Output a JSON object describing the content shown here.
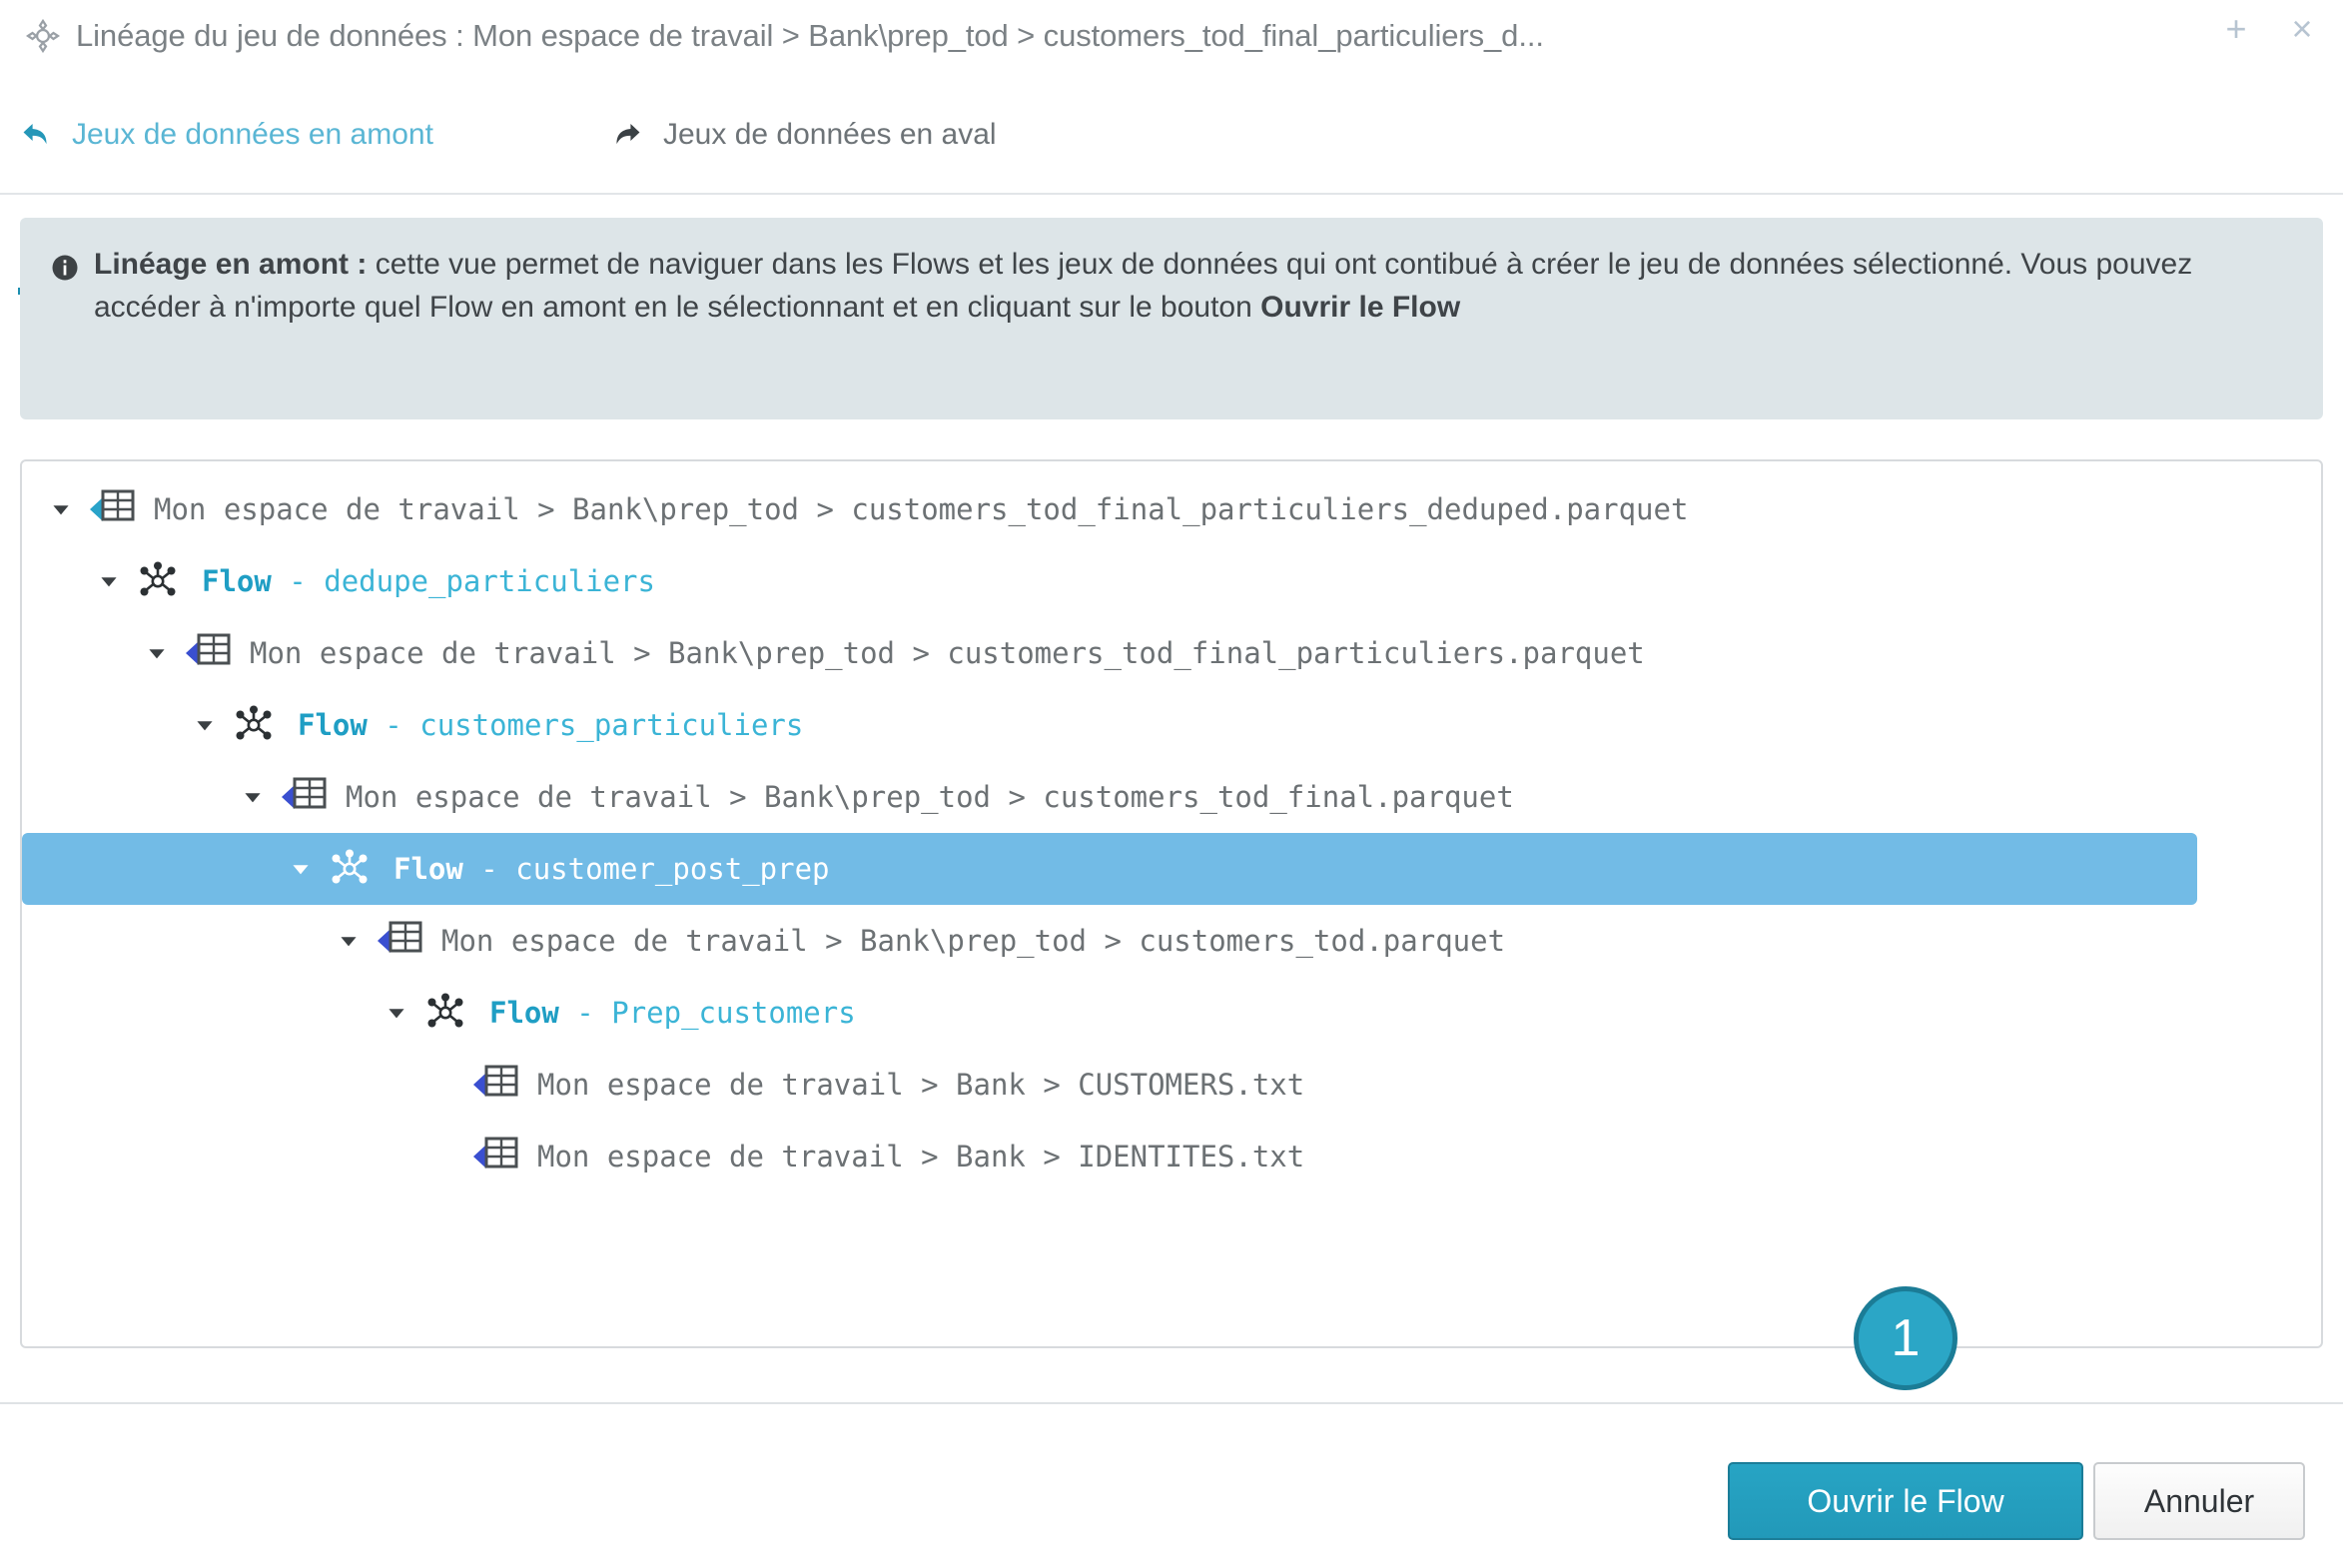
{
  "window": {
    "icon": "lineage-target-icon",
    "title": "Linéage du jeu de données : Mon espace de travail > Bank\\prep_tod > customers_tod_final_particuliers_d...",
    "add_label": "+",
    "close_label": "×"
  },
  "tabs": [
    {
      "id": "upstream",
      "label": "Jeux de données en amont",
      "icon": "arrow-back-icon",
      "active": true
    },
    {
      "id": "downstream",
      "label": "Jeux de données en aval",
      "icon": "arrow-forward-icon",
      "active": false
    }
  ],
  "banner": {
    "icon": "info-icon",
    "lead": "Linéage en amont :",
    "body": " cette vue permet de naviguer dans les Flows et les jeux de données qui ont contibué à créer le jeu de données sélectionné. Vous pouvez accéder à n'importe quel Flow en amont en le sélectionnant et en cliquant sur le bouton ",
    "emphasis": "Ouvrir le Flow"
  },
  "tree": {
    "rows": [
      {
        "depth": 0,
        "type": "dataset",
        "icon": "dataset-table-cyan-arrow-icon",
        "caret": "chevron-down-icon",
        "expanded": true,
        "selected": false,
        "label": "Mon espace de travail > Bank\\prep_tod > customers_tod_final_particuliers_deduped.parquet"
      },
      {
        "depth": 1,
        "type": "flow",
        "icon": "flow-graph-icon",
        "caret": "chevron-down-icon",
        "expanded": true,
        "selected": false,
        "keyword": "Flow",
        "separator": " - ",
        "name": "dedupe_particuliers"
      },
      {
        "depth": 2,
        "type": "dataset",
        "icon": "dataset-table-blue-arrow-icon",
        "caret": "chevron-down-icon",
        "expanded": true,
        "selected": false,
        "label": "Mon espace de travail > Bank\\prep_tod > customers_tod_final_particuliers.parquet"
      },
      {
        "depth": 3,
        "type": "flow",
        "icon": "flow-graph-icon",
        "caret": "chevron-down-icon",
        "expanded": true,
        "selected": false,
        "keyword": "Flow",
        "separator": " - ",
        "name": "customers_particuliers"
      },
      {
        "depth": 4,
        "type": "dataset",
        "icon": "dataset-table-blue-arrow-icon",
        "caret": "chevron-down-icon",
        "expanded": true,
        "selected": false,
        "label": "Mon espace de travail > Bank\\prep_tod > customers_tod_final.parquet"
      },
      {
        "depth": 5,
        "type": "flow",
        "icon": "flow-graph-icon",
        "caret": "chevron-down-icon",
        "expanded": true,
        "selected": true,
        "keyword": "Flow",
        "separator": " - ",
        "name": "customer_post_prep"
      },
      {
        "depth": 6,
        "type": "dataset",
        "icon": "dataset-table-blue-arrow-icon",
        "caret": "chevron-down-icon",
        "expanded": true,
        "selected": false,
        "label": "Mon espace de travail > Bank\\prep_tod > customers_tod.parquet"
      },
      {
        "depth": 7,
        "type": "flow",
        "icon": "flow-graph-icon",
        "caret": "chevron-down-icon",
        "expanded": true,
        "selected": false,
        "keyword": "Flow",
        "separator": " - ",
        "name": "Prep_customers"
      },
      {
        "depth": 8,
        "type": "dataset",
        "icon": "dataset-table-blue-arrow-icon",
        "caret": "none",
        "expanded": false,
        "selected": false,
        "label": "Mon espace de travail > Bank > CUSTOMERS.txt"
      },
      {
        "depth": 8,
        "type": "dataset",
        "icon": "dataset-table-blue-arrow-icon",
        "caret": "none",
        "expanded": false,
        "selected": false,
        "label": "Mon espace de travail > Bank > IDENTITES.txt"
      }
    ]
  },
  "badge": {
    "value": "1"
  },
  "footer": {
    "primary_label": "Ouvrir le Flow",
    "secondary_label": "Annuler"
  },
  "colors": {
    "accent_teal": "#2ba6c6",
    "tab_active_underline": "#1c8fb0",
    "selection_blue": "#72bbe6",
    "banner_bg": "#dde5e8",
    "dataset_arrow_blue": "#3a4fd0",
    "dataset_arrow_cyan": "#29a3c9",
    "flow_text": "#3bb4d6"
  }
}
